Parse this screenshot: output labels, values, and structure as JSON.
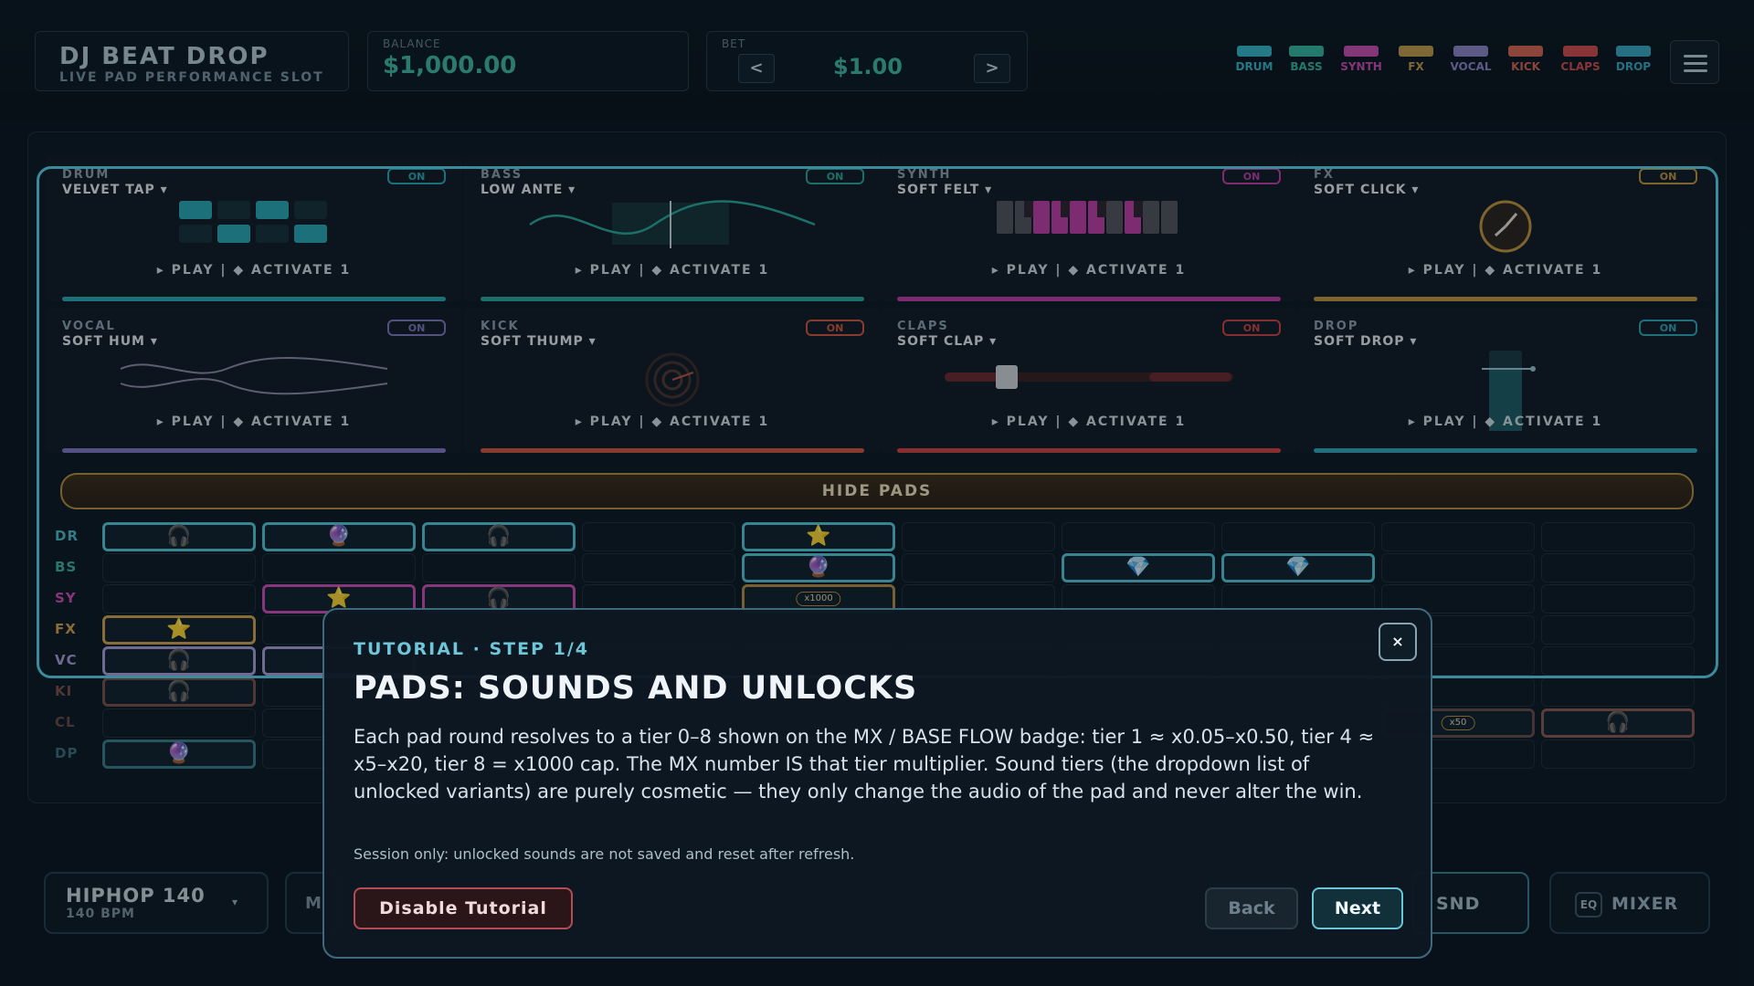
{
  "header": {
    "title": "DJ BEAT DROP",
    "subtitle": "LIVE PAD PERFORMANCE SLOT",
    "balance_label": "BALANCE",
    "balance_value": "$1,000.00",
    "bet_label": "BET",
    "bet_value": "$1.00",
    "bet_decrease": "<",
    "bet_increase": ">",
    "legend": [
      {
        "label": "DRUM",
        "color": "#37b6c6"
      },
      {
        "label": "BASS",
        "color": "#37b6a0"
      },
      {
        "label": "SYNTH",
        "color": "#c94fb0"
      },
      {
        "label": "FX",
        "color": "#c49a4c"
      },
      {
        "label": "VOCAL",
        "color": "#8e86c6"
      },
      {
        "label": "KICK",
        "color": "#d46650"
      },
      {
        "label": "CLAPS",
        "color": "#d24e4e"
      },
      {
        "label": "DROP",
        "color": "#39a8c2"
      }
    ]
  },
  "pads": [
    {
      "category": "DRUM",
      "name": "VELVET TAP ▾",
      "status": "ON",
      "actions": "▸ PLAY | ◆ ACTIVATE 1",
      "color": "#2aa8b3",
      "icon": "drum-grid-icon"
    },
    {
      "category": "BASS",
      "name": "LOW ANTE ▾",
      "status": "ON",
      "actions": "▸ PLAY | ◆ ACTIVATE 1",
      "color": "#2aa89a",
      "icon": "bass-wave-icon"
    },
    {
      "category": "SYNTH",
      "name": "SOFT FELT ▾",
      "status": "ON",
      "actions": "▸ PLAY | ◆ ACTIVATE 1",
      "color": "#c040a8",
      "icon": "keyboard-icon"
    },
    {
      "category": "FX",
      "name": "SOFT CLICK ▾",
      "status": "ON",
      "actions": "▸ PLAY | ◆ ACTIVATE 1",
      "color": "#c39540",
      "icon": "knob-icon"
    },
    {
      "category": "VOCAL",
      "name": "SOFT HUM ▾",
      "status": "ON",
      "actions": "▸ PLAY | ◆ ACTIVATE 1",
      "color": "#8078c0",
      "icon": "vocal-wave-icon"
    },
    {
      "category": "KICK",
      "name": "SOFT THUMP ▾",
      "status": "ON",
      "actions": "▸ PLAY | ◆ ACTIVATE 1",
      "color": "#d0583e",
      "icon": "kick-ring-icon"
    },
    {
      "category": "CLAPS",
      "name": "SOFT CLAP ▾",
      "status": "ON",
      "actions": "▸ PLAY | ◆ ACTIVATE 1",
      "color": "#cc4444",
      "icon": "fader-icon"
    },
    {
      "category": "DROP",
      "name": "SOFT DROP ▾",
      "status": "ON",
      "actions": "▸ PLAY | ◆ ACTIVATE 1",
      "color": "#2ea6b8",
      "icon": "drop-meter-icon"
    }
  ],
  "hide_pads_label": "HIDE PADS",
  "grid": {
    "rows": [
      {
        "label": "DR",
        "color": "#4fb8c9"
      },
      {
        "label": "BS",
        "color": "#3fb0a0"
      },
      {
        "label": "SY",
        "color": "#d04fb6"
      },
      {
        "label": "FX",
        "color": "#d2a24f"
      },
      {
        "label": "VC",
        "color": "#a89fd8"
      },
      {
        "label": "KI",
        "color": "#7a5148"
      },
      {
        "label": "CL",
        "color": "#6b4a4a"
      },
      {
        "label": "DP",
        "color": "#3a6f7a"
      }
    ],
    "multiplier_chip": "x1000",
    "multiplier_chip_2": "x50"
  },
  "footer": {
    "genre": "HIPHOP 140",
    "bpm": "140 BPM",
    "partial_left": "M",
    "snd_label": "SND",
    "eq_icon_label": "EQ",
    "mixer_label": "MIXER"
  },
  "tutorial": {
    "step": "TUTORIAL · STEP 1/4",
    "heading": "PADS: SOUNDS AND UNLOCKS",
    "body": "Each pad round resolves to a tier 0–8 shown on the MX / BASE FLOW badge: tier 1 ≈ x0.05–x0.50, tier 4 ≈ x5–x20, tier 8 = x1000 cap. The MX number IS that tier multiplier. Sound tiers (the dropdown list of unlocked variants) are purely cosmetic — they only change the audio of the pad and never alter the win.",
    "note": "Session only: unlocked sounds are not saved and reset after refresh.",
    "close": "×",
    "disable_label": "Disable Tutorial",
    "back_label": "Back",
    "next_label": "Next"
  }
}
